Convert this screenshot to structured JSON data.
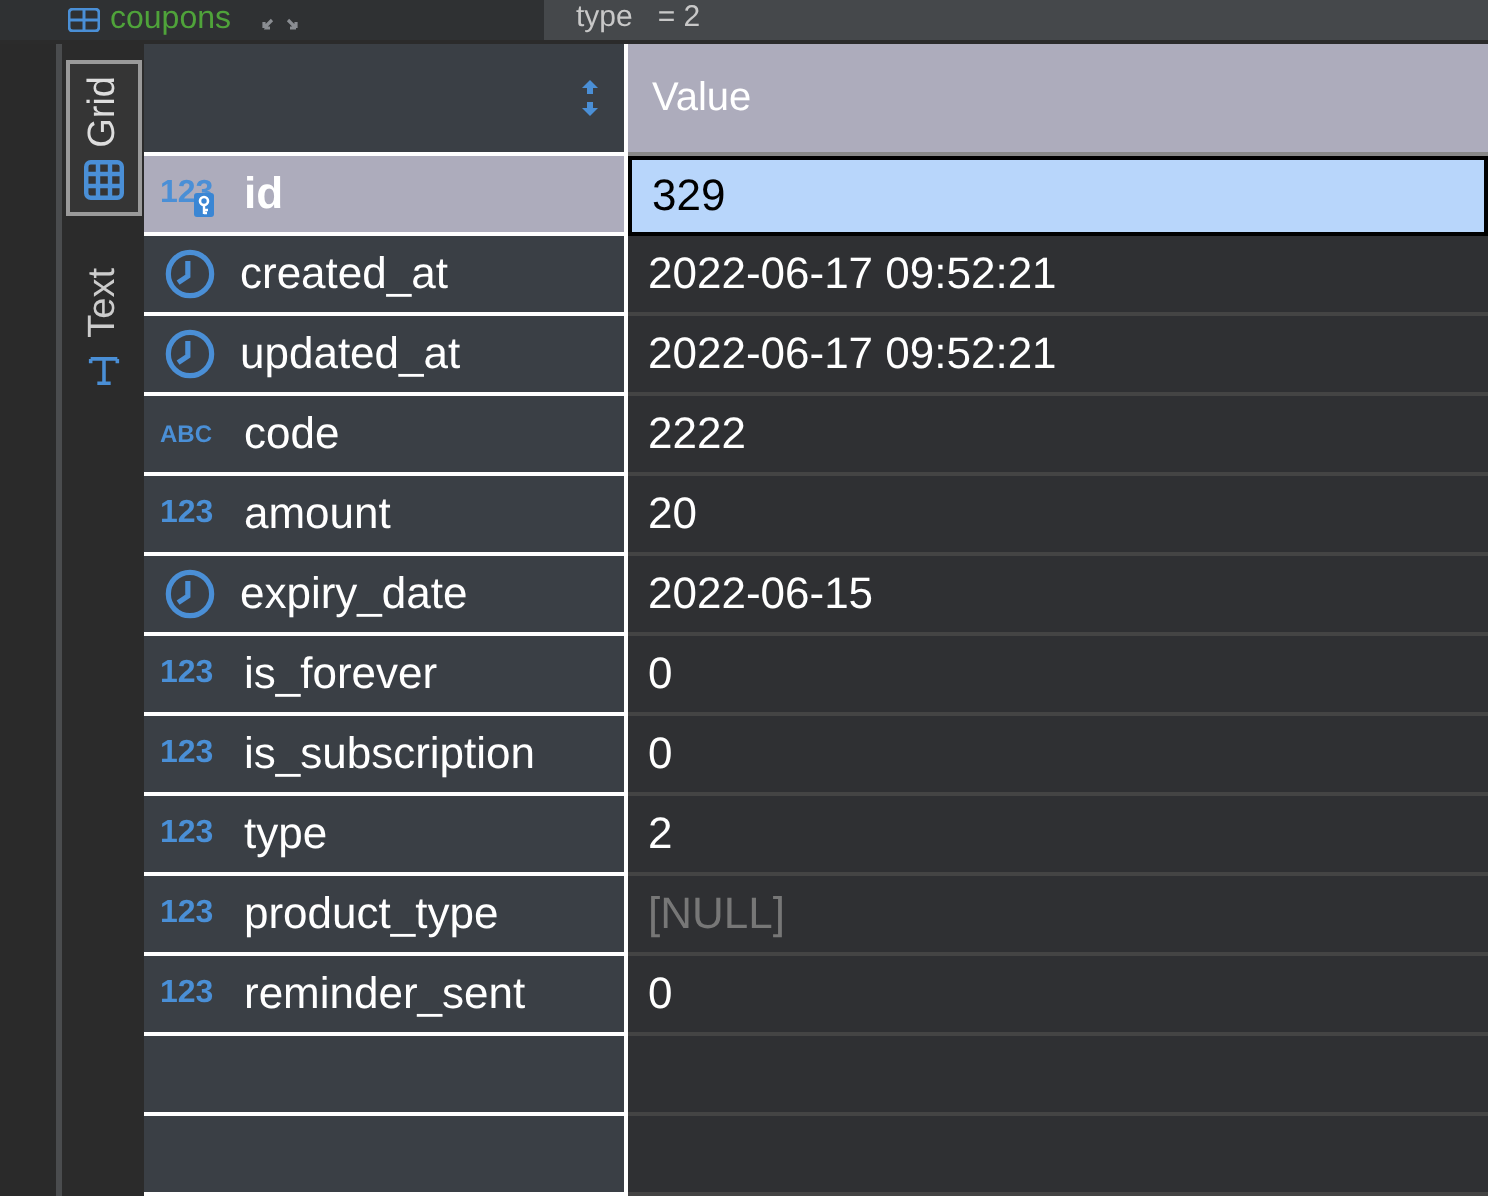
{
  "top_bar": {
    "table_name": "coupons",
    "filter": "type   = 2"
  },
  "view_tabs": [
    {
      "label": "Grid",
      "kind": "grid",
      "selected": true
    },
    {
      "label": "Text",
      "kind": "text",
      "selected": false
    }
  ],
  "table": {
    "columns": [
      "Value"
    ],
    "rows": [
      {
        "name": "id",
        "kind": "number",
        "type_label": "123",
        "key": true,
        "value": "329",
        "is_null": false,
        "selected": true
      },
      {
        "name": "created_at",
        "kind": "datetime",
        "key": false,
        "value": "2022-06-17 09:52:21",
        "is_null": false,
        "selected": false
      },
      {
        "name": "updated_at",
        "kind": "datetime",
        "key": false,
        "value": "2022-06-17 09:52:21",
        "is_null": false,
        "selected": false
      },
      {
        "name": "code",
        "kind": "string",
        "type_label": "ABC",
        "key": false,
        "value": "2222",
        "is_null": false,
        "selected": false
      },
      {
        "name": "amount",
        "kind": "number",
        "type_label": "123",
        "key": false,
        "value": "20",
        "is_null": false,
        "selected": false
      },
      {
        "name": "expiry_date",
        "kind": "datetime",
        "key": false,
        "value": "2022-06-15",
        "is_null": false,
        "selected": false
      },
      {
        "name": "is_forever",
        "kind": "number",
        "type_label": "123",
        "key": false,
        "value": "0",
        "is_null": false,
        "selected": false
      },
      {
        "name": "is_subscription",
        "kind": "number",
        "type_label": "123",
        "key": false,
        "value": "0",
        "is_null": false,
        "selected": false
      },
      {
        "name": "type",
        "kind": "number",
        "type_label": "123",
        "key": false,
        "value": "2",
        "is_null": false,
        "selected": false
      },
      {
        "name": "product_type",
        "kind": "number",
        "type_label": "123",
        "key": false,
        "value": "[NULL]",
        "is_null": true,
        "selected": false
      },
      {
        "name": "reminder_sent",
        "kind": "number",
        "type_label": "123",
        "key": false,
        "value": "0",
        "is_null": false,
        "selected": false
      }
    ]
  }
}
